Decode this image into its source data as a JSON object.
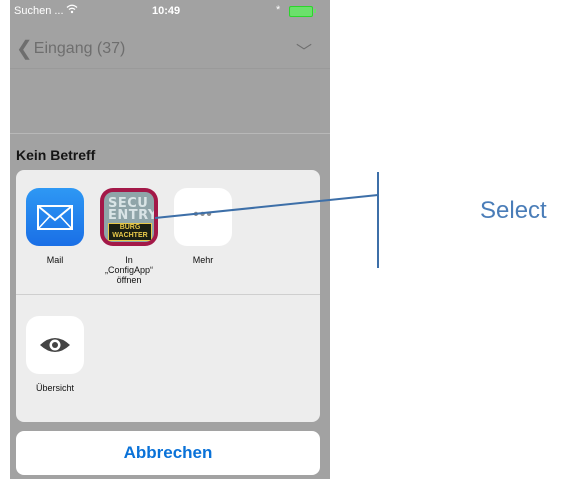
{
  "status_bar": {
    "carrier": "Suchen ...",
    "time": "10:49",
    "bluetooth": "*"
  },
  "nav": {
    "back_label": "Eingang (37)",
    "back_chevron": "❮",
    "down_chevron": "﹀"
  },
  "message": {
    "subject": "Kein Betreff"
  },
  "share_sheet": {
    "apps": [
      {
        "label": "Mail",
        "icon": "mail-icon"
      },
      {
        "label": "In „ConfigApp“ öffnen",
        "icon": "configapp-icon",
        "icon_text": [
          "SECU",
          "ENTRY"
        ],
        "badge_text": [
          "BURG",
          "WACHTER"
        ]
      },
      {
        "label": "Mehr",
        "icon": "more-icon",
        "glyph": "•••"
      }
    ],
    "actions": [
      {
        "label": "Übersicht",
        "icon": "eye-icon"
      }
    ],
    "cancel_label": "Abbrechen"
  },
  "annotation": {
    "label": "Select",
    "color": "#4a7db8"
  },
  "colors": {
    "accent": "#0a72d8",
    "overlay": "#a2a2a2",
    "config_icon": "#a31848"
  }
}
